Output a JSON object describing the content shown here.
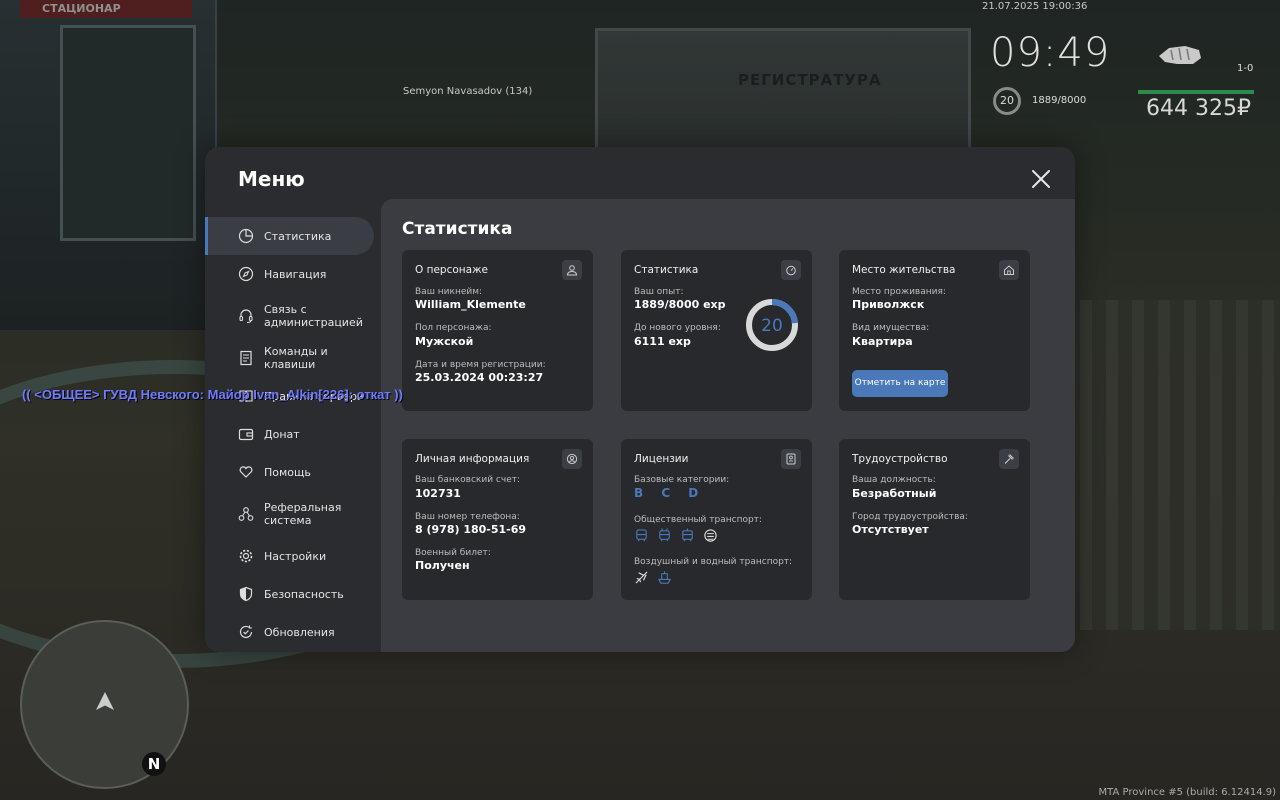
{
  "hud": {
    "datetime": "21.07.2025 19:00:36",
    "time": "09:49",
    "level": "20",
    "exp": "1889/8000",
    "wanted": "1-0",
    "money": "644 325₽",
    "player_tag": "Semyon Navasadov (134)",
    "chat_line": "(( <ОБЩЕЕ> ГУВД Невского: Майор Ivan_Alkin[226]: откат ))",
    "build": "MTA Province #5 (build: 6.12414.9)",
    "compass": "N",
    "building_sign": "СТАЦИОНАР",
    "counter_sign": "РЕГИСТРАТУРА"
  },
  "menu": {
    "title": "Меню",
    "sidebar": [
      {
        "label": "Статистика",
        "icon": "pie-chart-icon"
      },
      {
        "label": "Навигация",
        "icon": "compass-icon"
      },
      {
        "label": "Связь с администрацией",
        "icon": "headset-icon"
      },
      {
        "label": "Команды и клавиши",
        "icon": "document-icon"
      },
      {
        "label": "Правила сервера",
        "icon": "book-icon"
      },
      {
        "label": "Донат",
        "icon": "wallet-icon"
      },
      {
        "label": "Помощь",
        "icon": "heart-hand-icon"
      },
      {
        "label": "Реферальная система",
        "icon": "network-icon"
      },
      {
        "label": "Настройки",
        "icon": "gear-icon"
      },
      {
        "label": "Безопасность",
        "icon": "shield-icon"
      },
      {
        "label": "Обновления",
        "icon": "refresh-check-icon"
      }
    ]
  },
  "content": {
    "title": "Статистика",
    "character": {
      "title": "О персонаже",
      "nick_label": "Ваш никнейм:",
      "nick": "William_Klemente",
      "gender_label": "Пол персонажа:",
      "gender": "Мужской",
      "reg_label": "Дата и время регистрации:",
      "reg": "25.03.2024 00:23:27"
    },
    "stats": {
      "title": "Статистика",
      "exp_label": "Ваш опыт:",
      "exp": "1889/8000 exp",
      "next_label": "До нового уровня:",
      "next": "6111 exp",
      "level": "20",
      "progress": 0.236
    },
    "residence": {
      "title": "Место жительства",
      "place_label": "Место проживания:",
      "place": "Приволжск",
      "property_label": "Вид имущества:",
      "property": "Квартира",
      "button": "Отметить на карте"
    },
    "personal": {
      "title": "Личная информация",
      "bank_label": "Ваш банковский счет:",
      "bank": "102731",
      "phone_label": "Ваш номер телефона:",
      "phone": "8 (978) 180-51-69",
      "military_label": "Военный билет:",
      "military": "Получен"
    },
    "licenses": {
      "title": "Лицензии",
      "base_label": "Базовые категории:",
      "base": "B C D",
      "public_label": "Общественный транспорт:",
      "public_icons": [
        "bus-icon",
        "trolleybus-icon",
        "tram-icon",
        "metro-icon"
      ],
      "air_label": "Воздушный и водный транспорт:",
      "air_icons": [
        "plane-icon",
        "boat-icon"
      ]
    },
    "employment": {
      "title": "Трудоустройство",
      "position_label": "Ваша должность:",
      "position": "Безработный",
      "city_label": "Город трудоустройства:",
      "city": "Отсутствует"
    }
  },
  "colors": {
    "accent": "#4a78b8",
    "panel": "#2a2c30",
    "content": "#3a3c41",
    "card": "#27292d"
  }
}
